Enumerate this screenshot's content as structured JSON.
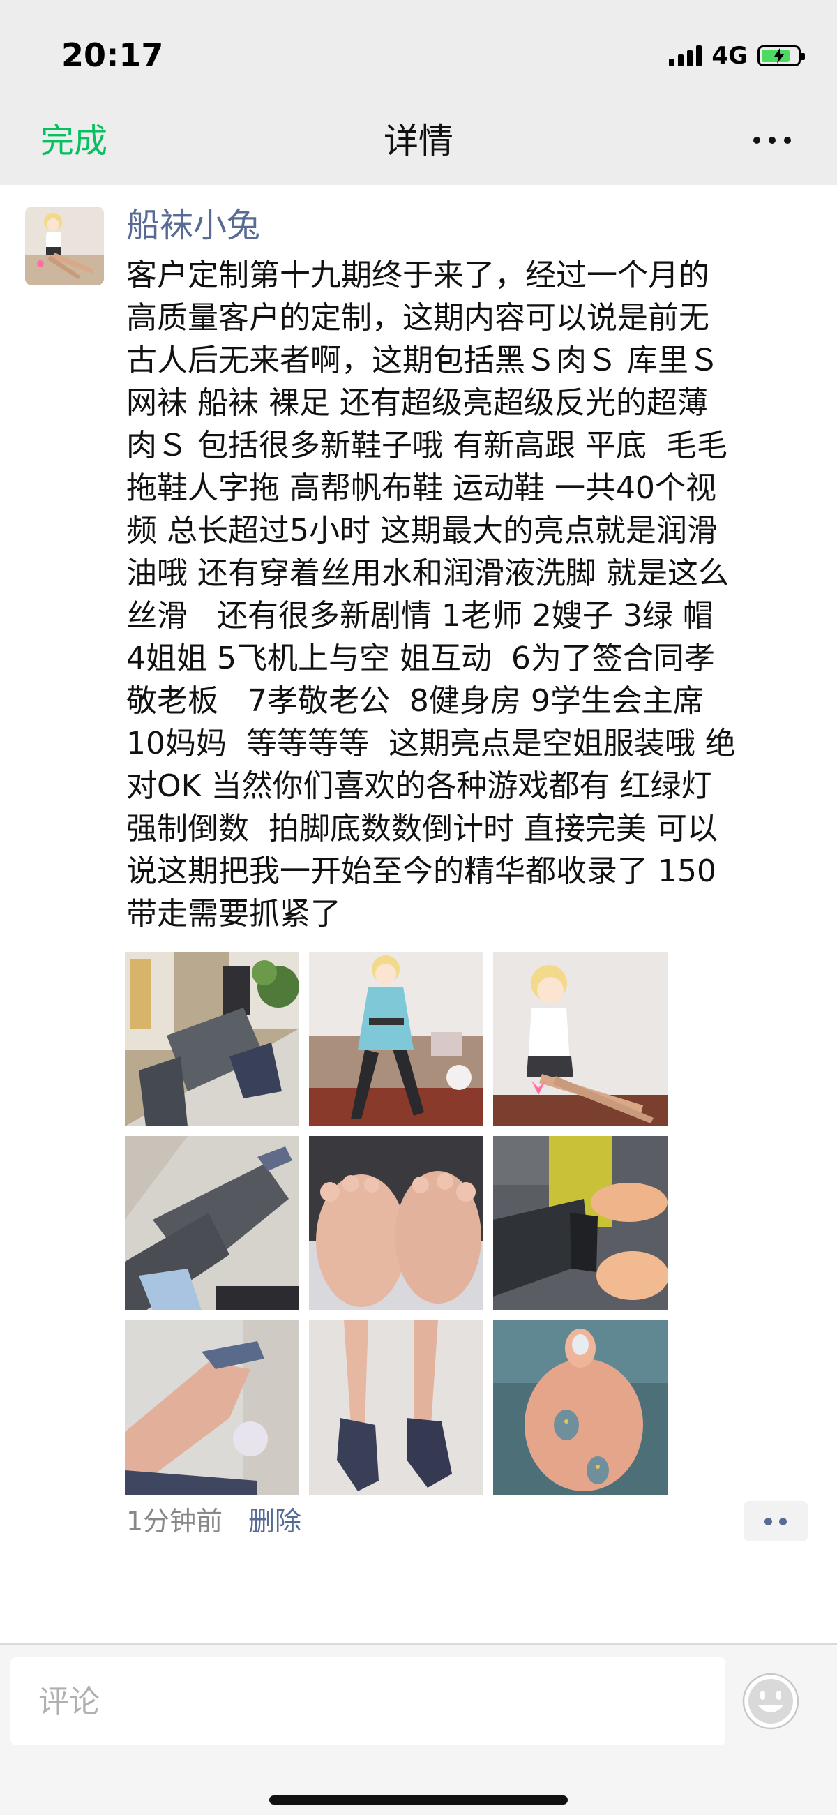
{
  "status_bar": {
    "time": "20:17",
    "network": "4G",
    "battery_level": 0.8,
    "battery_color": "#4cd964"
  },
  "nav": {
    "done_label": "完成",
    "title": "详情",
    "more_icon": "more-icon"
  },
  "post": {
    "author": "船袜小兔",
    "text": "客户定制第十九期终于来了，经过一个月的\n高质量客户的定制，这期内容可以说是前无\n古人后无来者啊，这期包括黑Ｓ肉Ｓ 库里Ｓ\n网袜 船袜 裸足 还有超级亮超级反光的超薄\n肉Ｓ 包括很多新鞋子哦 有新高跟 平底  毛毛\n拖鞋人字拖 高帮帆布鞋 运动鞋 一共40个视\n频 总长超过5小时 这期最大的亮点就是润滑\n油哦 还有穿着丝用水和润滑液洗脚 就是这么\n丝滑   还有很多新剧情 1老师 2嫂子 3绿 帽\n4姐姐 5飞机上与空 姐互动  6为了签合同孝\n敬老板   7孝敬老公  8健身房 9学生会主席\n10妈妈  等等等等  这期亮点是空姐服装哦 绝\n对OK 当然你们喜欢的各种游戏都有 红绿灯\n强制倒数  拍脚底数数倒计时 直接完美 可以\n说这期把我一开始至今的精华都收录了 150\n带走需要抓紧了",
    "photos": [
      {
        "name": "photo-1",
        "kind": "heels-room"
      },
      {
        "name": "photo-2",
        "kind": "figure-blue-dress"
      },
      {
        "name": "photo-3",
        "kind": "figure-white-shirt"
      },
      {
        "name": "photo-4",
        "kind": "legs-trousers"
      },
      {
        "name": "photo-5",
        "kind": "soles"
      },
      {
        "name": "photo-6",
        "kind": "sofa-feet"
      },
      {
        "name": "photo-7",
        "kind": "leg-closeup"
      },
      {
        "name": "photo-8",
        "kind": "glitter-heels"
      },
      {
        "name": "photo-9",
        "kind": "painted-toes"
      }
    ],
    "time_ago": "1分钟前",
    "delete_label": "删除"
  },
  "comment_bar": {
    "placeholder": "评论",
    "emoji_icon": "emoji-icon"
  },
  "colors": {
    "accent_green": "#07c160",
    "link_blue": "#576b95"
  }
}
